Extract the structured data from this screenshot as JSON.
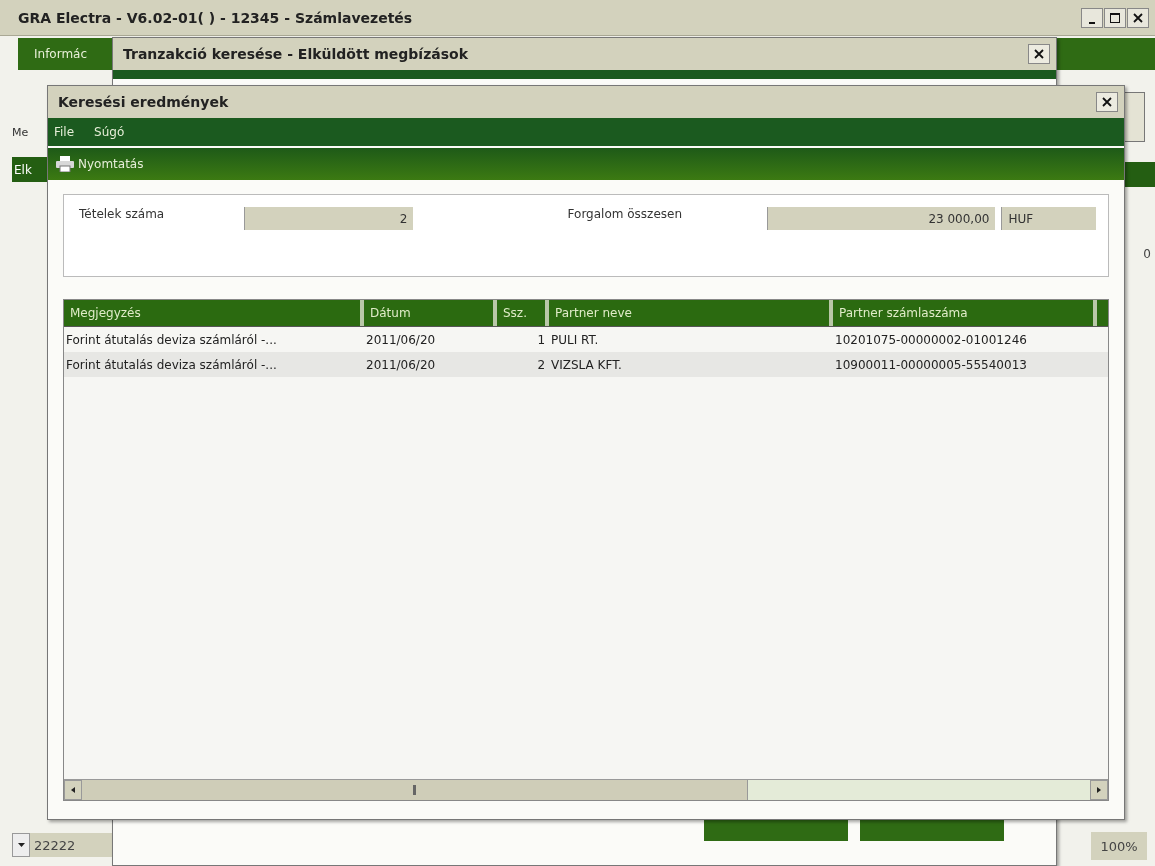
{
  "app_window": {
    "title": "GRA Electra - V6.02-01( ) - 12345 - Számlavezetés",
    "menu_tab": "Informác",
    "side_label": "Me",
    "side_tab": "Elk",
    "side_value": "0",
    "status": {
      "account": "22222",
      "zoom": "100%"
    }
  },
  "search_dialog": {
    "title": "Tranzakció keresése - Elküldött megbízások"
  },
  "results_dialog": {
    "title": "Keresési eredmények",
    "menu": [
      "File",
      "Súgó"
    ],
    "toolbar": [
      {
        "label": "Nyomtatás"
      }
    ],
    "summary": {
      "count_label": "Tételek száma",
      "count": "2",
      "total_label": "Forgalom összesen",
      "total": "23 000,00",
      "currency": "HUF"
    },
    "table": {
      "columns": [
        "Megjegyzés",
        "Dátum",
        "Ssz.",
        "Partner neve",
        "Partner számlaszáma"
      ],
      "rows": [
        {
          "cells": [
            "Forint átutalás deviza számláról  -...",
            "2011/06/20",
            "1",
            "PULI RT.",
            "10201075-00000002-01001246"
          ]
        },
        {
          "cells": [
            "Forint átutalás deviza számláról  -...",
            "2011/06/20",
            "2",
            "VIZSLA KFT.",
            "10900011-00000005-55540013"
          ]
        }
      ]
    }
  }
}
